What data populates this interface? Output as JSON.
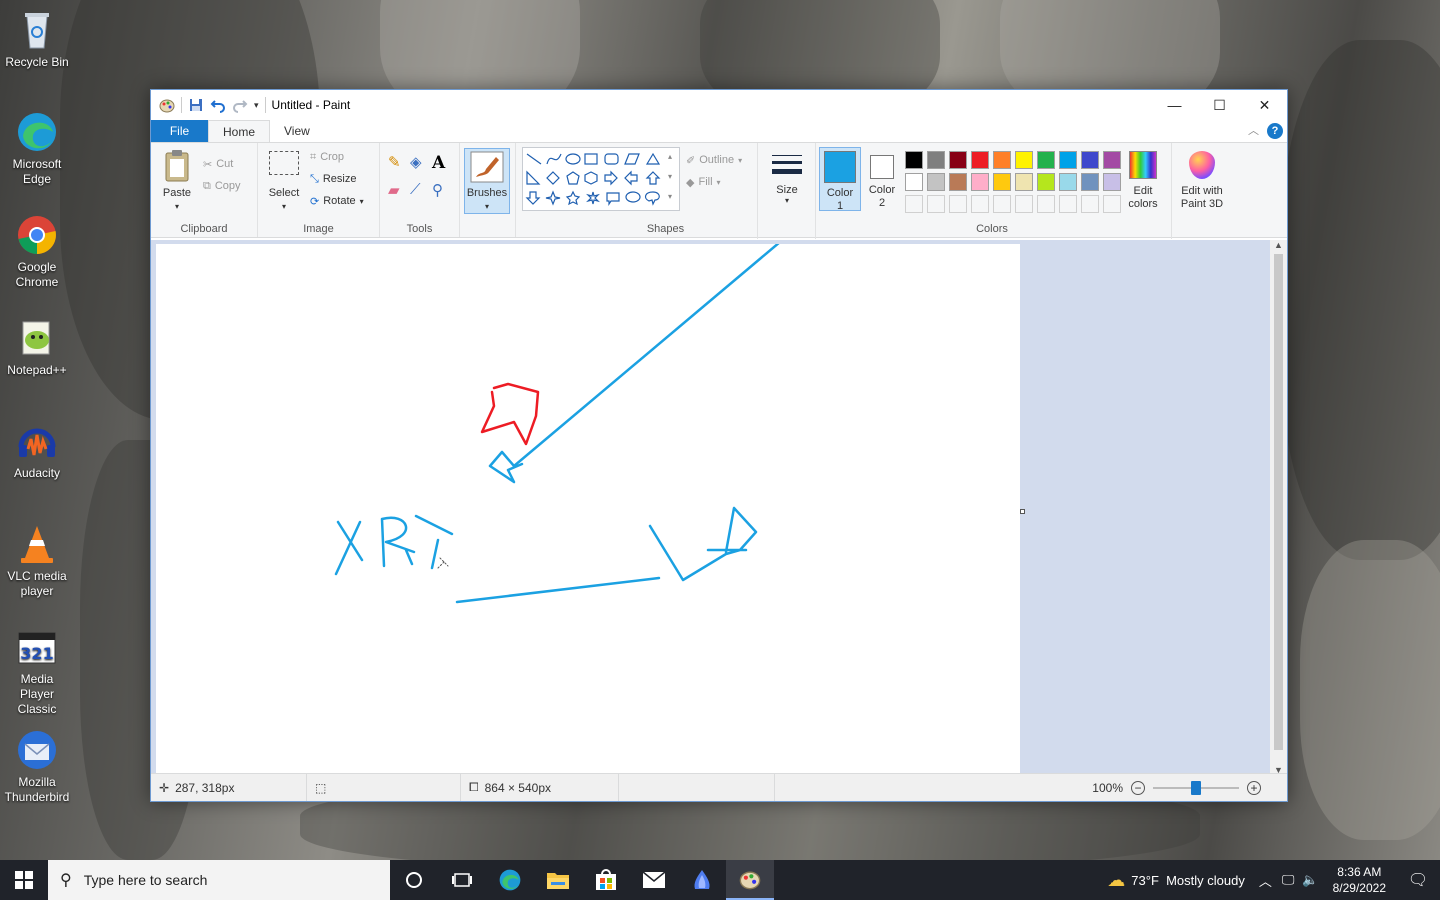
{
  "desktop": {
    "icons": [
      {
        "label": "Recycle Bin"
      },
      {
        "label": "Microsoft Edge"
      },
      {
        "label": "Google Chrome"
      },
      {
        "label": "Notepad++"
      },
      {
        "label": "Audacity"
      },
      {
        "label": "VLC media player"
      },
      {
        "label": "Media Player Classic"
      },
      {
        "label": "Mozilla Thunderbird"
      }
    ]
  },
  "window": {
    "title": "Untitled - Paint",
    "tabs": {
      "file": "File",
      "home": "Home",
      "view": "View"
    }
  },
  "ribbon": {
    "clipboard": {
      "label": "Clipboard",
      "paste": "Paste",
      "cut": "Cut",
      "copy": "Copy"
    },
    "image": {
      "label": "Image",
      "select": "Select",
      "crop": "Crop",
      "resize": "Resize",
      "rotate": "Rotate"
    },
    "tools": {
      "label": "Tools"
    },
    "brushes": {
      "label": "Brushes"
    },
    "shapes": {
      "label": "Shapes",
      "outline": "Outline",
      "fill": "Fill"
    },
    "size": {
      "label": "Size"
    },
    "colors": {
      "label": "Colors",
      "color1": "Color 1",
      "color2": "Color 2",
      "color1_value": "#1ba1e2",
      "color2_value": "#ffffff",
      "palette_row1": [
        "#000000",
        "#7f7f7f",
        "#880015",
        "#ed1c24",
        "#ff7f27",
        "#fff200",
        "#22b14c",
        "#00a2e8",
        "#3f48cc",
        "#a349a4"
      ],
      "palette_row2": [
        "#ffffff",
        "#c3c3c3",
        "#b97a57",
        "#ffaec9",
        "#ffc90e",
        "#efe4b0",
        "#b5e61d",
        "#99d9ea",
        "#7092be",
        "#c8bfe7"
      ],
      "edit_colors": "Edit colors",
      "edit_3d": "Edit with Paint 3D"
    }
  },
  "status": {
    "cursor_pos": "287, 318px",
    "canvas_size": "864 × 540px",
    "zoom": "100%"
  },
  "taskbar": {
    "search_placeholder": "Type here to search",
    "weather": "73°F  Mostly cloudy",
    "time": "8:36 AM",
    "date": "8/29/2022"
  }
}
